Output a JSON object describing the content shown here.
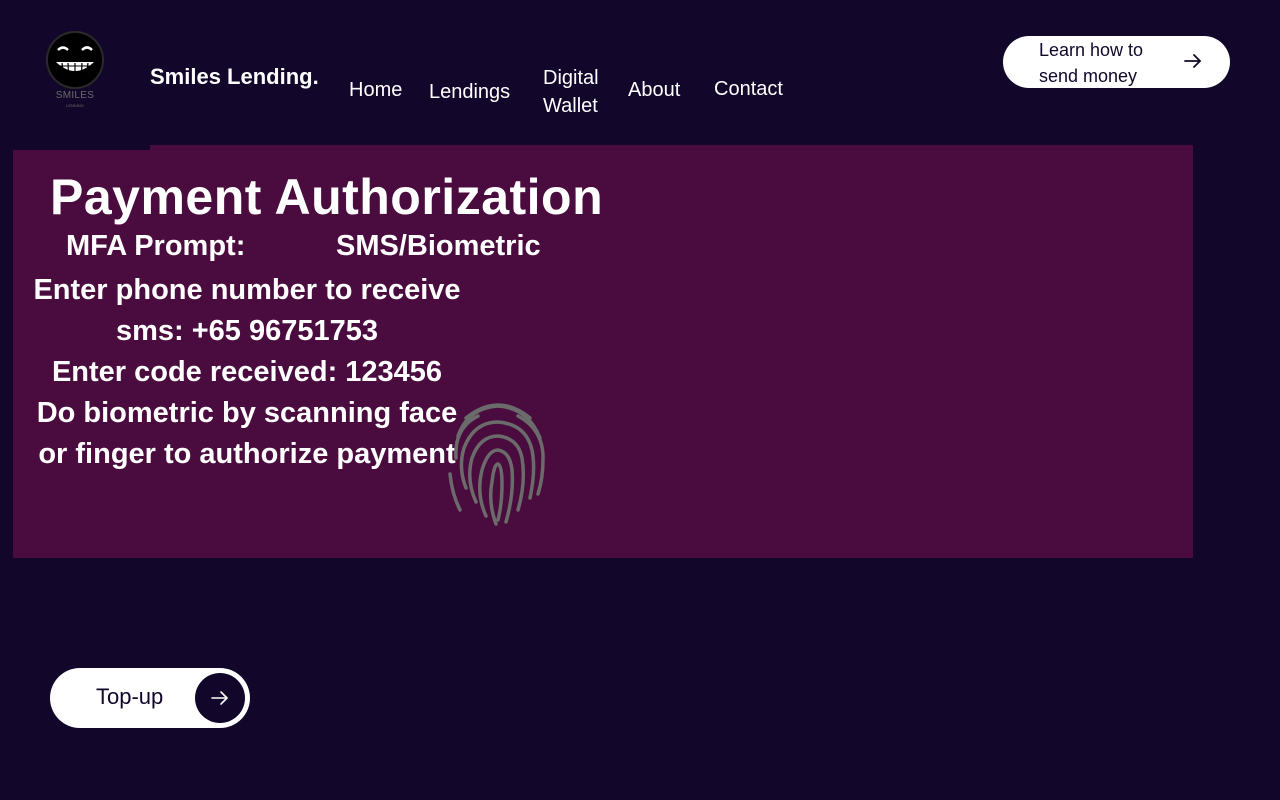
{
  "logo": {
    "text": "SMILES",
    "subtext": "LENDING",
    "icon": "smiley-face-icon"
  },
  "brand": {
    "name": "Smiles Lending."
  },
  "nav": {
    "home": "Home",
    "lendings": "Lendings",
    "wallet": "Digital Wallet",
    "about": "About",
    "contact": "Contact"
  },
  "learn_button": {
    "label": "Learn how to send money",
    "icon": "arrow-right-icon"
  },
  "panel": {
    "title": "Payment Authorization",
    "mfa_label": "MFA Prompt:",
    "mfa_value": "SMS/Biometric",
    "phone_line": "Enter phone number to receive sms: +65 96751753",
    "code_line": "Enter code received: 123456",
    "biometric_line": "Do biometric by scanning face or finger to authorize payment",
    "fingerprint_icon": "fingerprint-icon"
  },
  "topup_button": {
    "label": "Top-up",
    "icon": "arrow-right-icon"
  },
  "colors": {
    "background": "#12072b",
    "panel": "#4a0c3e",
    "button": "#ffffff",
    "fingerprint": "#6b6b6b"
  }
}
